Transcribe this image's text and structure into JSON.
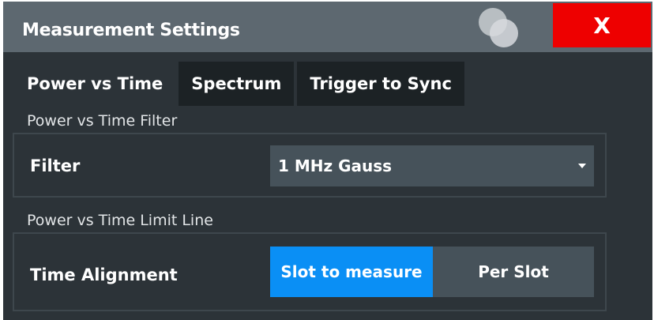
{
  "dialog": {
    "title": "Measurement Settings",
    "close_label": "X"
  },
  "tabs": [
    {
      "label": "Power vs Time",
      "active": true
    },
    {
      "label": "Spectrum",
      "active": false
    },
    {
      "label": "Trigger to Sync",
      "active": false
    }
  ],
  "filter_section": {
    "heading": "Power vs Time Filter",
    "field_label": "Filter",
    "selected_value": "1 MHz Gauss"
  },
  "limit_section": {
    "heading": "Power vs Time Limit Line",
    "field_label": "Time Alignment",
    "options": [
      "Slot to measure",
      "Per Slot"
    ],
    "selected_option": "Slot to measure"
  },
  "colors": {
    "titlebar": "#5d6870",
    "panel": "#2c3338",
    "close_button": "#ee0000",
    "selected_option": "#0a8ff5"
  }
}
